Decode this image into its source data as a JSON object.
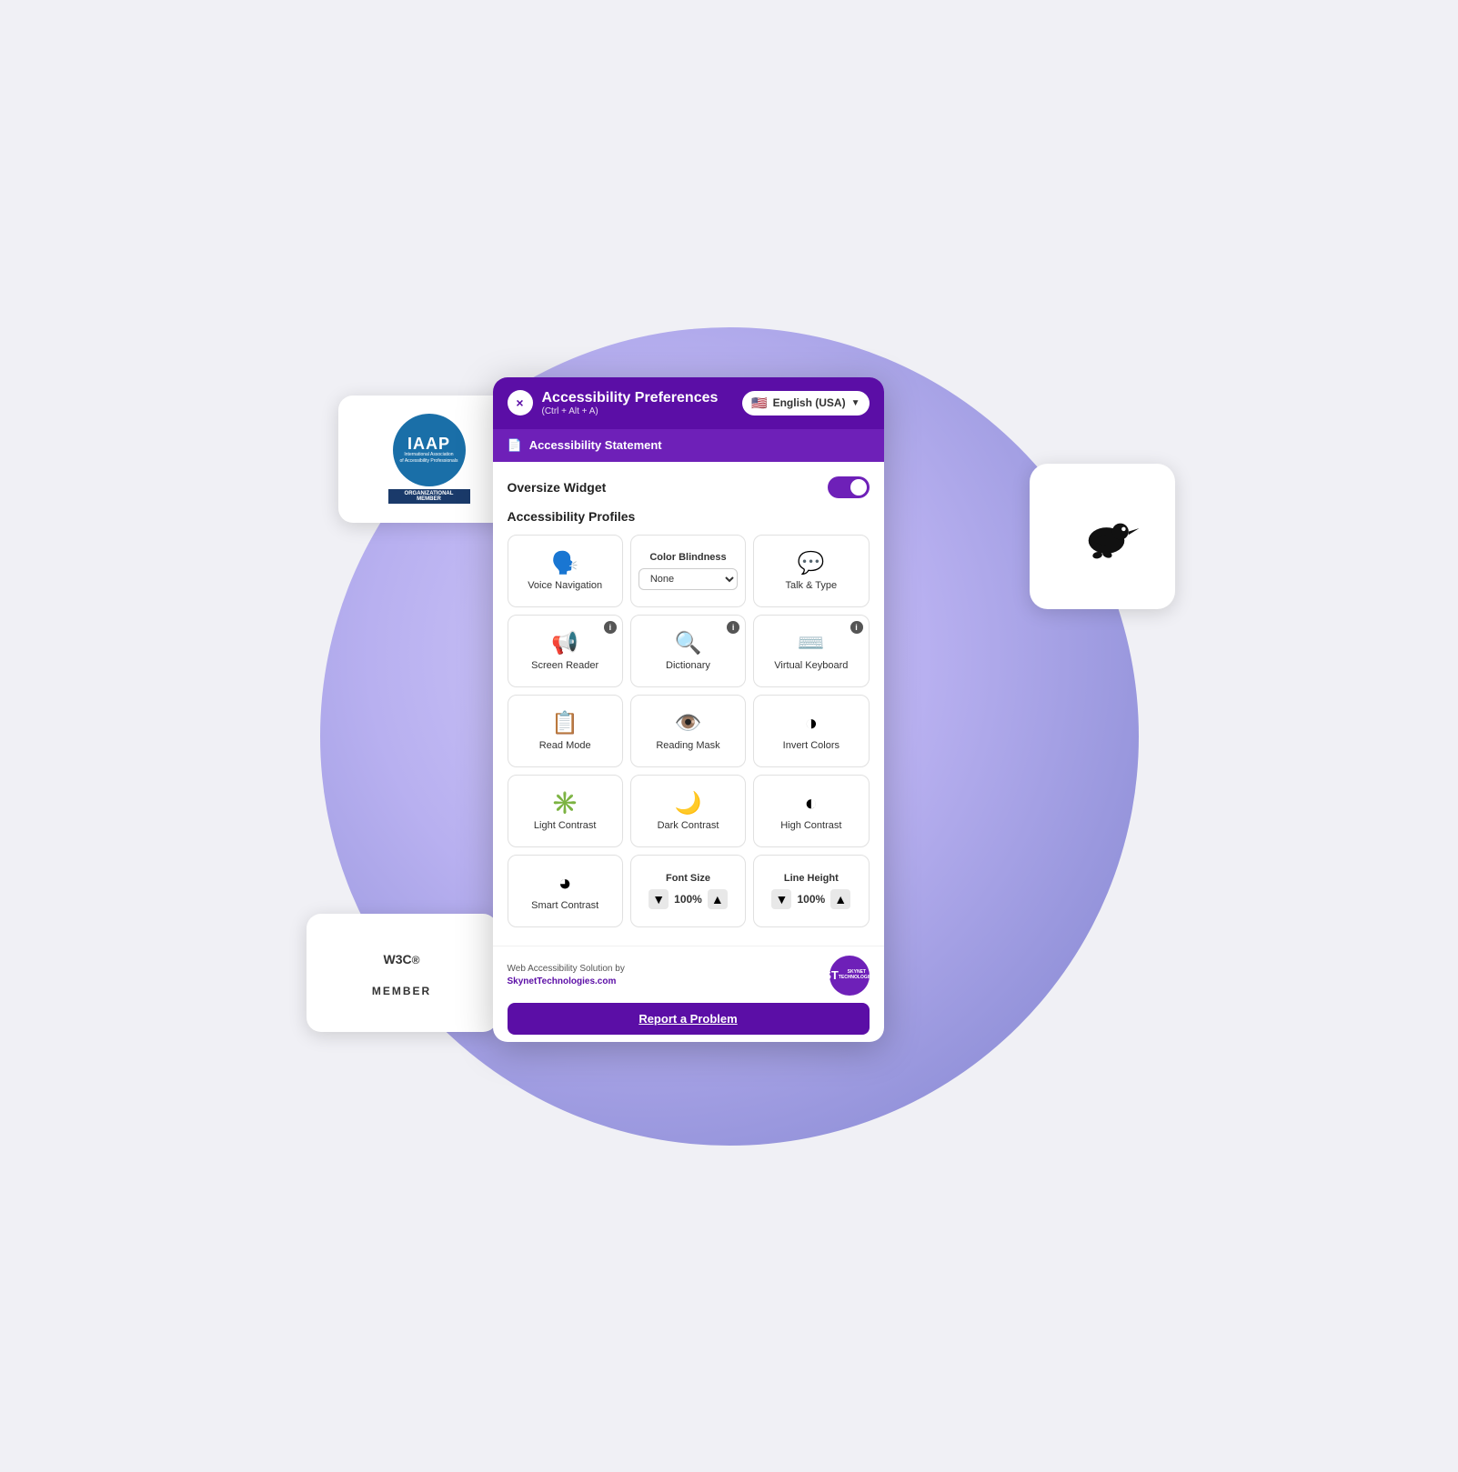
{
  "header": {
    "title": "Accessibility Preferences",
    "shortcut": "(Ctrl + Alt + A)",
    "close_label": "×",
    "lang_label": "English (USA)",
    "flag": "🇺🇸"
  },
  "statement_bar": {
    "icon": "📄",
    "label": "Accessibility Statement"
  },
  "oversize": {
    "label": "Oversize Widget",
    "toggle_on": true
  },
  "profiles": {
    "label": "Accessibility Profiles"
  },
  "cells": {
    "voice_navigation": "Voice Navigation",
    "color_blindness": "Color Blindness",
    "color_blindness_value": "None",
    "talk_type": "Talk & Type",
    "screen_reader": "Screen Reader",
    "dictionary": "Dictionary",
    "virtual_keyboard": "Virtual Keyboard",
    "read_mode": "Read Mode",
    "reading_mask": "Reading Mask",
    "invert_colors": "Invert Colors",
    "light_contrast": "Light Contrast",
    "dark_contrast": "Dark Contrast",
    "high_contrast": "High Contrast",
    "smart_contrast": "Smart Contrast",
    "font_size_label": "Font Size",
    "font_size_value": "100%",
    "line_height_label": "Line Height",
    "line_height_value": "100%"
  },
  "footer": {
    "branding_line1": "Web Accessibility Solution by",
    "branding_link": "SkynetTechnologies.com",
    "logo_text": "ST",
    "logo_subtext": "SKYNET\nTECHNOLOGIES",
    "report_btn": "Report a Problem"
  },
  "iaap": {
    "main": "IAAP",
    "sub": "International Association\nof Accessibility Professionals",
    "org": "ORGANIZATIONAL MEMBER"
  },
  "w3c": {
    "logo": "W3C",
    "reg": "®",
    "member": "MEMBER"
  }
}
